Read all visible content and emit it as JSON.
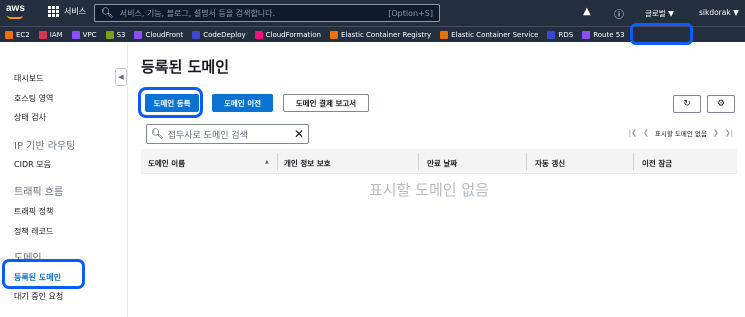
{
  "topbar": {
    "logo": "aws",
    "services_label": "서비스",
    "search_placeholder": "서비스, 기능, 블로그, 설명서 등을 검색합니다.",
    "search_shortcut": "[Option+S]",
    "region": "글로벌 ▼",
    "account": "sikdorak ▼"
  },
  "favorites": [
    {
      "label": "EC2",
      "color": "#ed7100"
    },
    {
      "label": "IAM",
      "color": "#dd344c"
    },
    {
      "label": "VPC",
      "color": "#8c4fff"
    },
    {
      "label": "S3",
      "color": "#7aa116"
    },
    {
      "label": "CloudFront",
      "color": "#8c4fff"
    },
    {
      "label": "CodeDeploy",
      "color": "#3b48cc"
    },
    {
      "label": "CloudFormation",
      "color": "#e7157b"
    },
    {
      "label": "Elastic Container Registry",
      "color": "#ed7100"
    },
    {
      "label": "Elastic Container Service",
      "color": "#ed7100"
    },
    {
      "label": "RDS",
      "color": "#3b48cc"
    },
    {
      "label": "Route 53",
      "color": "#8c4fff"
    }
  ],
  "sidebar": {
    "items": [
      {
        "label": "대시보드"
      },
      {
        "label": "호스팅 영역"
      },
      {
        "label": "상태 검사"
      },
      {
        "label": "IP 기반 라우팅"
      },
      {
        "label": "CIDR 모음"
      },
      {
        "label": "트래픽 흐름"
      },
      {
        "label": "트래픽 정책"
      },
      {
        "label": "정책 레코드"
      },
      {
        "label": "도메인"
      },
      {
        "label": "등록된 도메인"
      },
      {
        "label": "대기 중인 요청"
      }
    ]
  },
  "main": {
    "title": "등록된 도메인",
    "buttons": {
      "register": "도메인 등록",
      "transfer": "도메인 이전",
      "billing_report": "도메인 결제 보고서"
    },
    "filter_placeholder": "접두사로 도메인 검색",
    "pager_label": "표시할 도메인 없음",
    "columns": [
      "도메인 이름",
      "개인 정보 보호",
      "만료 날짜",
      "자동 갱신",
      "이전 잠금"
    ],
    "empty_text": "표시할 도메인 없음"
  }
}
